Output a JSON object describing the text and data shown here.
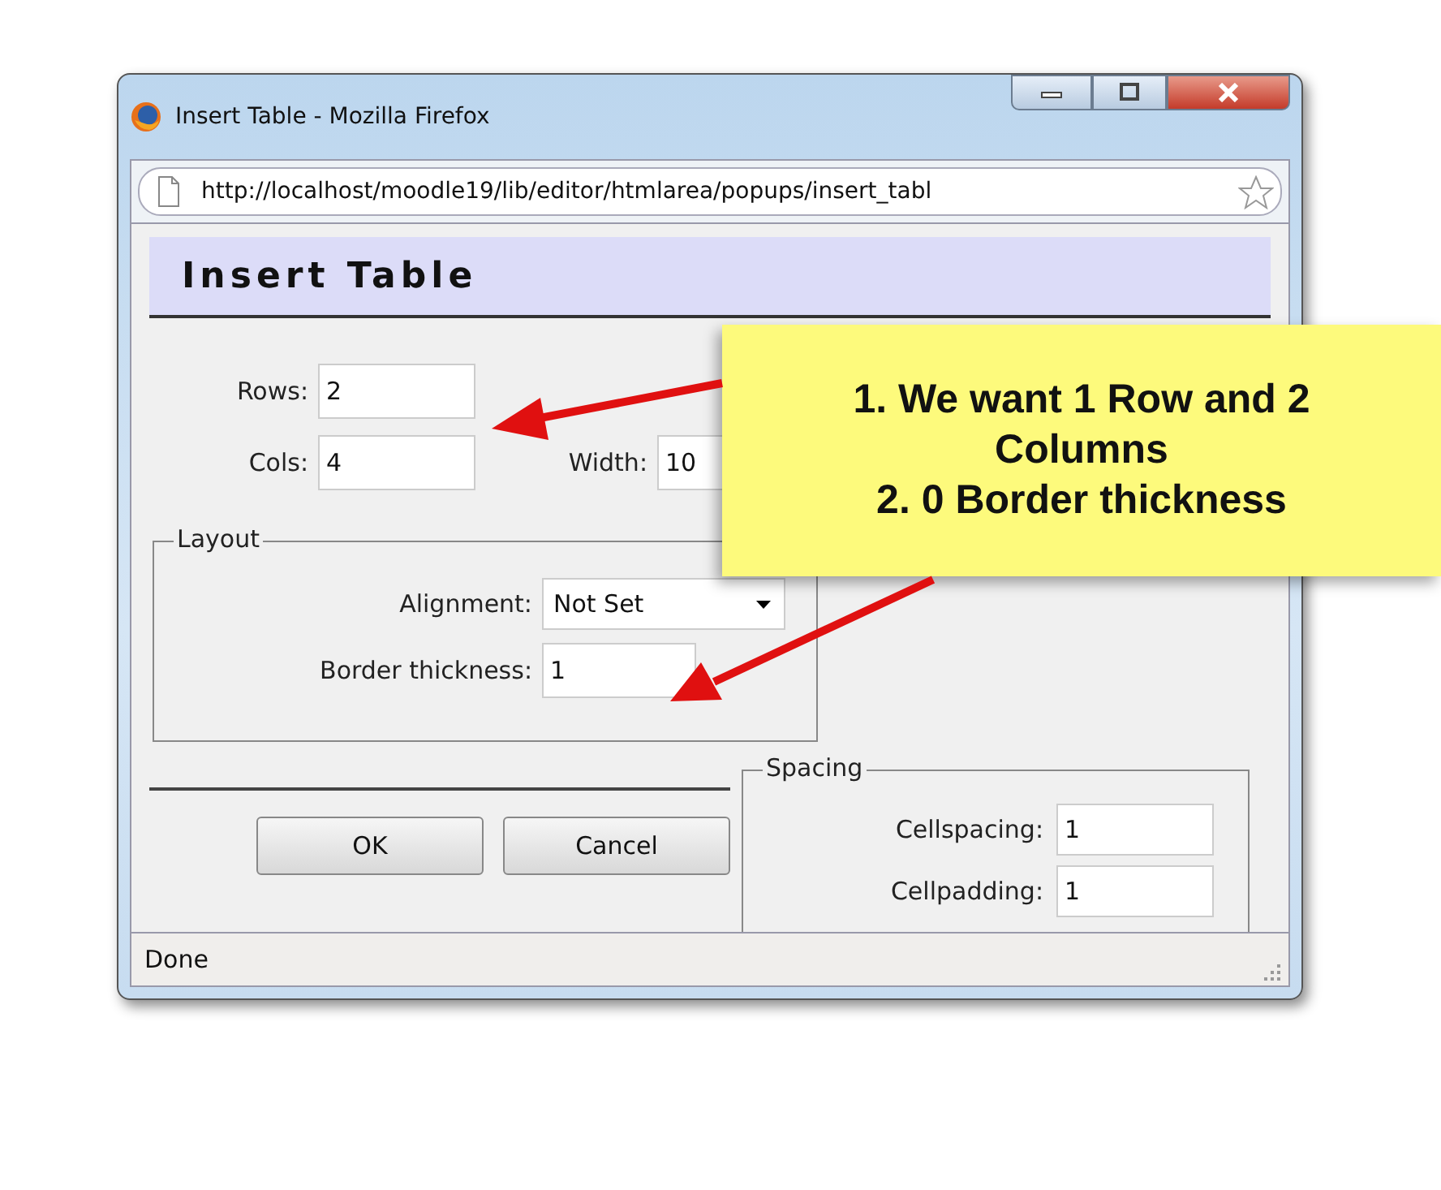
{
  "window": {
    "title": "Insert Table - Mozilla Firefox"
  },
  "address_bar": {
    "url": "http://localhost/moodle19/lib/editor/htmlarea/popups/insert_tabl"
  },
  "dialog": {
    "heading": "Insert Table",
    "fields": [
      {
        "label": "Rows:",
        "value": "2"
      },
      {
        "label": "Cols:",
        "value": "4"
      },
      {
        "label": "Width:",
        "value": "10"
      }
    ],
    "layout": {
      "legend": "Layout",
      "alignment": {
        "label": "Alignment:",
        "value": "Not Set"
      },
      "border": {
        "label": "Border thickness:",
        "value": "1"
      }
    },
    "buttons": [
      "OK",
      "Cancel"
    ],
    "spacing": {
      "legend": "Spacing",
      "fields": [
        {
          "label": "Cellspacing:",
          "value": "1"
        },
        {
          "label": "Cellpadding:",
          "value": "1"
        }
      ]
    }
  },
  "status_bar": {
    "text": "Done"
  },
  "callout": {
    "lines": [
      "1. We want 1 Row and 2",
      "Columns",
      "2. 0 Border thickness"
    ]
  }
}
